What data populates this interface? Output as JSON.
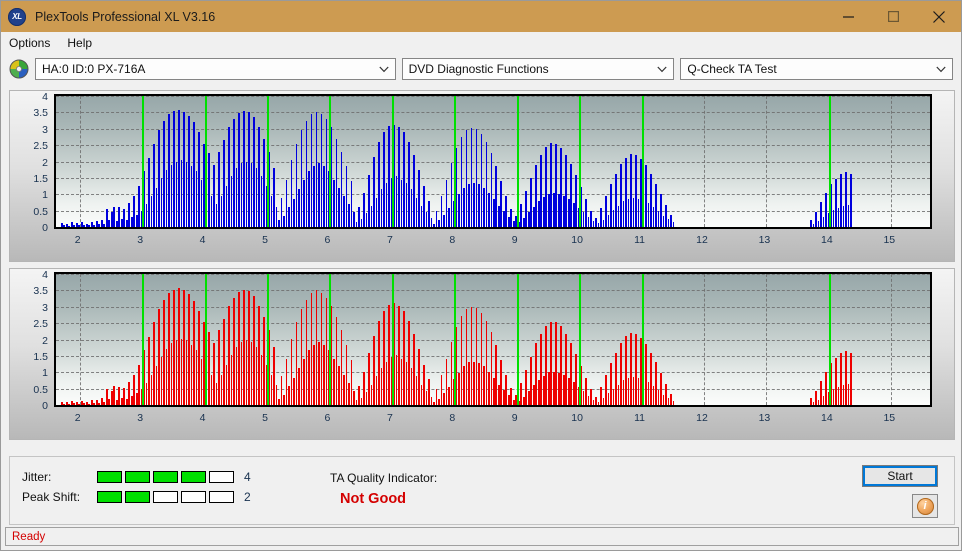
{
  "window": {
    "title": "PlexTools Professional XL V3.16",
    "app_icon": "xl-logo-icon",
    "minimize": "minimize-icon",
    "maximize": "maximize-icon",
    "close": "close-icon"
  },
  "menu": {
    "items": [
      "Options",
      "Help"
    ]
  },
  "toolbar": {
    "drive_icon": "disc-icon",
    "drive": "HA:0 ID:0  PX-716A",
    "function": "DVD Diagnostic Functions",
    "test": "Q-Check TA Test"
  },
  "status": {
    "jitter_label": "Jitter:",
    "jitter_value": "4",
    "jitter_filled": 4,
    "jitter_total": 5,
    "peakshift_label": "Peak Shift:",
    "peakshift_value": "2",
    "peakshift_filled": 2,
    "peakshift_total": 5,
    "tqi_label": "TA Quality Indicator:",
    "tqi_value": "Not Good",
    "tqi_color": "#d40000",
    "start_label": "Start",
    "info_label": "i",
    "ready": "Ready",
    "meter_on_color": "#00e000"
  },
  "chart_data": [
    {
      "id": "top",
      "type": "bar",
      "title": "",
      "xlabel": "",
      "ylabel": "",
      "series_color": "#0000dd",
      "marker_color": "#00e000",
      "xlim": [
        1.62,
        15.62
      ],
      "ylim": [
        0,
        4
      ],
      "yticks": [
        0,
        0.5,
        1,
        1.5,
        2,
        2.5,
        3,
        3.5,
        4
      ],
      "ytick_labels": [
        "0",
        "0.5",
        "1",
        "1.5",
        "2",
        "2.5",
        "3",
        "3.5",
        "4"
      ],
      "xticks": [
        2,
        3,
        4,
        5,
        6,
        7,
        8,
        9,
        10,
        11,
        12,
        13,
        14,
        15
      ],
      "xtick_labels": [
        "2",
        "3",
        "4",
        "5",
        "6",
        "7",
        "8",
        "9",
        "10",
        "11",
        "12",
        "13",
        "14",
        "15"
      ],
      "grid": true,
      "markers": [
        3,
        4,
        5,
        6,
        7,
        8,
        9,
        10,
        11,
        14
      ],
      "bar_step": 0.04,
      "x": [
        1.7,
        1.74,
        1.78,
        1.82,
        1.86,
        1.9,
        1.94,
        1.98,
        2.02,
        2.06,
        2.1,
        2.14,
        2.18,
        2.22,
        2.26,
        2.3,
        2.34,
        2.38,
        2.42,
        2.46,
        2.5,
        2.54,
        2.58,
        2.62,
        2.66,
        2.7,
        2.74,
        2.78,
        2.82,
        2.86,
        2.9,
        2.94,
        2.98,
        3.02,
        3.06,
        3.1,
        3.14,
        3.18,
        3.22,
        3.26,
        3.3,
        3.34,
        3.38,
        3.42,
        3.46,
        3.5,
        3.54,
        3.58,
        3.62,
        3.66,
        3.7,
        3.74,
        3.78,
        3.82,
        3.86,
        3.9,
        3.94,
        3.98,
        4.02,
        4.06,
        4.1,
        4.14,
        4.18,
        4.22,
        4.26,
        4.3,
        4.34,
        4.38,
        4.42,
        4.46,
        4.5,
        4.54,
        4.58,
        4.62,
        4.66,
        4.7,
        4.74,
        4.78,
        4.82,
        4.86,
        4.9,
        4.94,
        4.98,
        5.02,
        5.06,
        5.1,
        5.14,
        5.18,
        5.22,
        5.26,
        5.3,
        5.34,
        5.38,
        5.42,
        5.46,
        5.5,
        5.54,
        5.58,
        5.62,
        5.66,
        5.7,
        5.74,
        5.78,
        5.82,
        5.86,
        5.9,
        5.94,
        5.98,
        6.02,
        6.06,
        6.1,
        6.14,
        6.18,
        6.22,
        6.26,
        6.3,
        6.34,
        6.38,
        6.42,
        6.46,
        6.5,
        6.54,
        6.58,
        6.62,
        6.66,
        6.7,
        6.74,
        6.78,
        6.82,
        6.86,
        6.9,
        6.94,
        6.98,
        7.02,
        7.06,
        7.1,
        7.14,
        7.18,
        7.22,
        7.26,
        7.3,
        7.34,
        7.38,
        7.42,
        7.46,
        7.5,
        7.54,
        7.58,
        7.62,
        7.66,
        7.7,
        7.74,
        7.78,
        7.82,
        7.86,
        7.9,
        7.94,
        7.98,
        8.02,
        8.06,
        8.1,
        8.14,
        8.18,
        8.22,
        8.26,
        8.3,
        8.34,
        8.38,
        8.42,
        8.46,
        8.5,
        8.54,
        8.58,
        8.62,
        8.66,
        8.7,
        8.74,
        8.78,
        8.82,
        8.86,
        8.9,
        8.94,
        8.98,
        9.02,
        9.06,
        9.1,
        9.14,
        9.18,
        9.22,
        9.26,
        9.3,
        9.34,
        9.38,
        9.42,
        9.46,
        9.5,
        9.54,
        9.58,
        9.62,
        9.66,
        9.7,
        9.74,
        9.78,
        9.82,
        9.86,
        9.9,
        9.94,
        9.98,
        10.02,
        10.06,
        10.1,
        10.14,
        10.18,
        10.22,
        10.26,
        10.3,
        10.34,
        10.38,
        10.42,
        10.46,
        10.5,
        10.54,
        10.58,
        10.62,
        10.66,
        10.7,
        10.74,
        10.78,
        10.82,
        10.86,
        10.9,
        10.94,
        10.98,
        11.02,
        11.06,
        11.1,
        11.14,
        11.18,
        11.22,
        11.26,
        11.3,
        11.34,
        11.38,
        11.42,
        11.46,
        11.5,
        13.7,
        13.74,
        13.78,
        13.82,
        13.86,
        13.9,
        13.94,
        13.98,
        14.02,
        14.06,
        14.1,
        14.14,
        14.18,
        14.22,
        14.26,
        14.3,
        14.34
      ],
      "values": [
        0.12,
        0.05,
        0.1,
        0.04,
        0.14,
        0.06,
        0.12,
        0.05,
        0.14,
        0.06,
        0.1,
        0.05,
        0.16,
        0.07,
        0.18,
        0.08,
        0.22,
        0.1,
        0.55,
        0.2,
        0.45,
        0.62,
        0.18,
        0.6,
        0.24,
        0.55,
        0.2,
        0.72,
        0.3,
        0.95,
        0.38,
        1.25,
        0.5,
        1.7,
        0.7,
        2.1,
        0.95,
        2.55,
        1.2,
        2.95,
        1.5,
        3.25,
        1.75,
        3.45,
        1.9,
        3.55,
        2.0,
        3.58,
        2.05,
        3.52,
        2.0,
        3.4,
        1.85,
        3.2,
        1.7,
        2.9,
        1.45,
        2.55,
        1.2,
        2.25,
        0.95,
        1.9,
        0.7,
        2.3,
        0.95,
        2.65,
        1.25,
        3.05,
        1.55,
        3.3,
        1.8,
        3.48,
        1.95,
        3.55,
        2.0,
        3.5,
        1.95,
        3.35,
        1.8,
        3.05,
        1.55,
        2.7,
        1.25,
        2.3,
        0.95,
        1.8,
        0.62,
        0.2,
        0.9,
        0.35,
        1.45,
        0.6,
        2.05,
        0.85,
        2.55,
        1.15,
        2.95,
        1.45,
        3.25,
        1.7,
        3.45,
        1.85,
        3.52,
        1.95,
        3.45,
        1.85,
        3.3,
        1.7,
        3.05,
        1.45,
        2.7,
        1.2,
        2.3,
        0.95,
        1.85,
        0.7,
        1.4,
        0.45,
        0.15,
        0.6,
        0.25,
        1.05,
        0.42,
        1.6,
        0.65,
        2.15,
        0.9,
        2.6,
        1.15,
        2.9,
        1.35,
        3.08,
        1.5,
        3.12,
        1.55,
        3.05,
        1.45,
        2.9,
        1.35,
        2.6,
        1.15,
        2.2,
        0.9,
        1.75,
        0.65,
        1.25,
        0.45,
        0.8,
        0.28,
        0.1,
        0.5,
        0.2,
        0.95,
        0.38,
        1.45,
        0.58,
        1.95,
        0.8,
        2.4,
        1.0,
        2.75,
        1.2,
        2.95,
        1.32,
        3.02,
        1.35,
        2.98,
        1.3,
        2.85,
        1.2,
        2.6,
        1.05,
        2.25,
        0.85,
        1.85,
        0.65,
        1.4,
        0.48,
        0.95,
        0.32,
        0.55,
        0.18,
        0.35,
        0.14,
        0.7,
        0.28,
        1.1,
        0.45,
        1.5,
        0.62,
        1.9,
        0.78,
        2.2,
        0.92,
        2.45,
        1.02,
        2.58,
        1.05,
        2.55,
        1.0,
        2.42,
        0.95,
        2.2,
        0.85,
        1.92,
        0.72,
        1.58,
        0.58,
        1.22,
        0.45,
        0.85,
        0.3,
        0.5,
        0.18,
        0.28,
        0.12,
        0.58,
        0.22,
        0.95,
        0.38,
        1.3,
        0.52,
        1.62,
        0.65,
        1.92,
        0.78,
        2.12,
        0.85,
        2.22,
        0.88,
        2.2,
        0.85,
        2.08,
        0.8,
        1.88,
        0.72,
        1.62,
        0.6,
        1.32,
        0.48,
        1.0,
        0.35,
        0.68,
        0.24,
        0.38,
        0.15,
        0.22,
        0.1,
        0.45,
        0.18,
        0.75,
        0.3,
        1.05,
        0.42,
        1.3,
        0.52,
        1.48,
        0.58,
        1.62,
        0.64,
        1.68,
        0.66,
        1.62,
        0.62,
        1.45,
        0.55,
        1.2,
        0.45,
        0.92,
        0.34,
        0.62,
        0.22,
        0.35,
        0.14,
        0.18,
        0.08,
        0.15,
        0.1,
        0.55,
        0.9,
        1.25,
        1.5,
        1.68,
        1.78,
        1.82,
        1.75,
        1.62,
        1.4,
        1.1,
        0.8,
        0.5,
        0.28,
        0.12,
        0.15,
        0.08
      ]
    },
    {
      "id": "bottom",
      "type": "bar",
      "title": "",
      "xlabel": "",
      "ylabel": "",
      "series_color": "#ee0000",
      "marker_color": "#00e000",
      "xlim": [
        1.62,
        15.62
      ],
      "ylim": [
        0,
        4
      ],
      "yticks": [
        0,
        0.5,
        1,
        1.5,
        2,
        2.5,
        3,
        3.5,
        4
      ],
      "ytick_labels": [
        "0",
        "0.5",
        "1",
        "1.5",
        "2",
        "2.5",
        "3",
        "3.5",
        "4"
      ],
      "xticks": [
        2,
        3,
        4,
        5,
        6,
        7,
        8,
        9,
        10,
        11,
        12,
        13,
        14,
        15
      ],
      "xtick_labels": [
        "2",
        "3",
        "4",
        "5",
        "6",
        "7",
        "8",
        "9",
        "10",
        "11",
        "12",
        "13",
        "14",
        "15"
      ],
      "grid": true,
      "markers": [
        3,
        4,
        5,
        6,
        7,
        8,
        9,
        10,
        11,
        14
      ],
      "bar_step": 0.04,
      "x": [
        1.7,
        1.74,
        1.78,
        1.82,
        1.86,
        1.9,
        1.94,
        1.98,
        2.02,
        2.06,
        2.1,
        2.14,
        2.18,
        2.22,
        2.26,
        2.3,
        2.34,
        2.38,
        2.42,
        2.46,
        2.5,
        2.54,
        2.58,
        2.62,
        2.66,
        2.7,
        2.74,
        2.78,
        2.82,
        2.86,
        2.9,
        2.94,
        2.98,
        3.02,
        3.06,
        3.1,
        3.14,
        3.18,
        3.22,
        3.26,
        3.3,
        3.34,
        3.38,
        3.42,
        3.46,
        3.5,
        3.54,
        3.58,
        3.62,
        3.66,
        3.7,
        3.74,
        3.78,
        3.82,
        3.86,
        3.9,
        3.94,
        3.98,
        4.02,
        4.06,
        4.1,
        4.14,
        4.18,
        4.22,
        4.26,
        4.3,
        4.34,
        4.38,
        4.42,
        4.46,
        4.5,
        4.54,
        4.58,
        4.62,
        4.66,
        4.7,
        4.74,
        4.78,
        4.82,
        4.86,
        4.9,
        4.94,
        4.98,
        5.02,
        5.06,
        5.1,
        5.14,
        5.18,
        5.22,
        5.26,
        5.3,
        5.34,
        5.38,
        5.42,
        5.46,
        5.5,
        5.54,
        5.58,
        5.62,
        5.66,
        5.7,
        5.74,
        5.78,
        5.82,
        5.86,
        5.9,
        5.94,
        5.98,
        6.02,
        6.06,
        6.1,
        6.14,
        6.18,
        6.22,
        6.26,
        6.3,
        6.34,
        6.38,
        6.42,
        6.46,
        6.5,
        6.54,
        6.58,
        6.62,
        6.66,
        6.7,
        6.74,
        6.78,
        6.82,
        6.86,
        6.9,
        6.94,
        6.98,
        7.02,
        7.06,
        7.1,
        7.14,
        7.18,
        7.22,
        7.26,
        7.3,
        7.34,
        7.38,
        7.42,
        7.46,
        7.5,
        7.54,
        7.58,
        7.62,
        7.66,
        7.7,
        7.74,
        7.78,
        7.82,
        7.86,
        7.9,
        7.94,
        7.98,
        8.02,
        8.06,
        8.1,
        8.14,
        8.18,
        8.22,
        8.26,
        8.3,
        8.34,
        8.38,
        8.42,
        8.46,
        8.5,
        8.54,
        8.58,
        8.62,
        8.66,
        8.7,
        8.74,
        8.78,
        8.82,
        8.86,
        8.9,
        8.94,
        8.98,
        9.02,
        9.06,
        9.1,
        9.14,
        9.18,
        9.22,
        9.26,
        9.3,
        9.34,
        9.38,
        9.42,
        9.46,
        9.5,
        9.54,
        9.58,
        9.62,
        9.66,
        9.7,
        9.74,
        9.78,
        9.82,
        9.86,
        9.9,
        9.94,
        9.98,
        10.02,
        10.06,
        10.1,
        10.14,
        10.18,
        10.22,
        10.26,
        10.3,
        10.34,
        10.38,
        10.42,
        10.46,
        10.5,
        10.54,
        10.58,
        10.62,
        10.66,
        10.7,
        10.74,
        10.78,
        10.82,
        10.86,
        10.9,
        10.94,
        10.98,
        11.02,
        11.06,
        11.1,
        11.14,
        11.18,
        11.22,
        11.26,
        11.3,
        11.34,
        11.38,
        11.42,
        11.46,
        11.5,
        13.7,
        13.74,
        13.78,
        13.82,
        13.86,
        13.9,
        13.94,
        13.98,
        14.02,
        14.06,
        14.1,
        14.14,
        14.18,
        14.22,
        14.26,
        14.3,
        14.34
      ],
      "values": [
        0.1,
        0.04,
        0.08,
        0.04,
        0.12,
        0.05,
        0.1,
        0.04,
        0.12,
        0.05,
        0.09,
        0.04,
        0.14,
        0.06,
        0.16,
        0.07,
        0.2,
        0.09,
        0.5,
        0.18,
        0.42,
        0.58,
        0.16,
        0.56,
        0.22,
        0.52,
        0.18,
        0.7,
        0.28,
        0.92,
        0.36,
        1.22,
        0.48,
        1.68,
        0.68,
        2.08,
        0.92,
        2.52,
        1.18,
        2.92,
        1.48,
        3.22,
        1.72,
        3.42,
        1.88,
        3.52,
        1.98,
        3.56,
        2.02,
        3.5,
        1.98,
        3.38,
        1.82,
        3.18,
        1.68,
        2.88,
        1.42,
        2.52,
        1.18,
        2.22,
        0.92,
        1.88,
        0.68,
        2.28,
        0.92,
        2.62,
        1.22,
        3.02,
        1.52,
        3.28,
        1.78,
        3.46,
        1.92,
        3.52,
        1.98,
        3.48,
        1.92,
        3.32,
        1.78,
        3.02,
        1.52,
        2.68,
        1.22,
        2.28,
        0.92,
        1.78,
        0.6,
        0.18,
        0.88,
        0.32,
        1.42,
        0.58,
        2.02,
        0.82,
        2.52,
        1.12,
        2.92,
        1.42,
        3.22,
        1.68,
        3.42,
        1.82,
        3.5,
        1.92,
        3.42,
        1.82,
        3.28,
        1.68,
        3.02,
        1.42,
        2.68,
        1.18,
        2.28,
        0.92,
        1.82,
        0.68,
        1.38,
        0.42,
        0.14,
        0.58,
        0.22,
        1.02,
        0.4,
        1.58,
        0.62,
        2.12,
        0.88,
        2.58,
        1.12,
        2.88,
        1.32,
        3.05,
        1.48,
        3.1,
        1.52,
        3.02,
        1.42,
        2.88,
        1.32,
        2.58,
        1.12,
        2.18,
        0.88,
        1.72,
        0.62,
        1.22,
        0.42,
        0.78,
        0.26,
        0.08,
        0.48,
        0.18,
        0.92,
        0.36,
        1.42,
        0.56,
        1.92,
        0.78,
        2.38,
        0.98,
        2.72,
        1.18,
        2.92,
        1.3,
        3.0,
        1.32,
        2.95,
        1.28,
        2.82,
        1.18,
        2.58,
        1.02,
        2.22,
        0.82,
        1.82,
        0.62,
        1.38,
        0.46,
        0.92,
        0.3,
        0.52,
        0.16,
        0.32,
        0.12,
        0.68,
        0.26,
        1.08,
        0.42,
        1.48,
        0.6,
        1.88,
        0.76,
        2.18,
        0.9,
        2.42,
        1.0,
        2.55,
        1.02,
        2.52,
        0.98,
        2.4,
        0.92,
        2.18,
        0.82,
        1.9,
        0.7,
        1.55,
        0.56,
        1.2,
        0.42,
        0.82,
        0.28,
        0.48,
        0.16,
        0.26,
        0.1,
        0.55,
        0.2,
        0.92,
        0.36,
        1.28,
        0.5,
        1.6,
        0.62,
        1.9,
        0.76,
        2.1,
        0.82,
        2.2,
        0.86,
        2.18,
        0.82,
        2.05,
        0.78,
        1.85,
        0.7,
        1.6,
        0.58,
        1.3,
        0.46,
        0.98,
        0.32,
        0.65,
        0.22,
        0.35,
        0.13,
        0.2,
        0.08,
        0.42,
        0.16,
        0.72,
        0.28,
        1.02,
        0.4,
        1.28,
        0.5,
        1.45,
        0.56,
        1.6,
        0.62,
        1.66,
        0.64,
        1.6,
        0.6,
        1.42,
        0.52,
        1.18,
        0.42,
        0.9,
        0.32,
        0.6,
        0.2,
        0.32,
        0.12,
        0.16,
        0.06,
        0.12,
        0.08,
        0.52,
        0.88,
        1.22,
        1.48,
        1.65,
        1.75,
        1.8,
        1.72,
        1.6,
        1.38,
        1.08,
        0.78,
        0.48,
        0.26,
        0.1,
        0.12,
        0.06
      ]
    }
  ]
}
